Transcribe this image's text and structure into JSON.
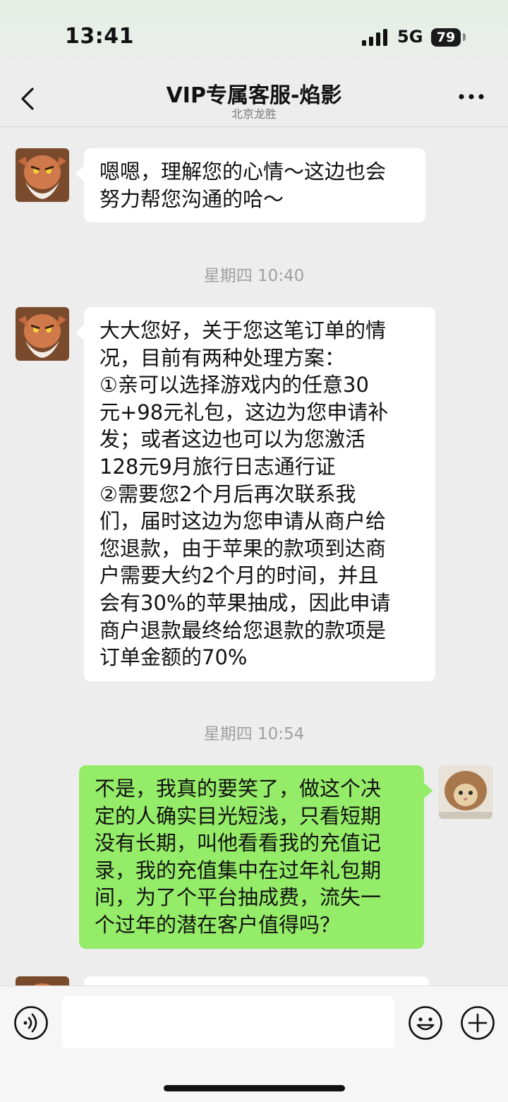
{
  "status_bar": {
    "time": "13:41",
    "network": "5G",
    "battery": "79"
  },
  "header": {
    "title": "VIP专属客服-焰影",
    "subtitle": "北京龙胜",
    "back_icon": "chevron-left-icon",
    "more_icon": "more-dots-icon"
  },
  "messages": [
    {
      "sender": "agent",
      "text": "嗯嗯，理解您的心情～这边也会\n努力帮您沟通的哈～"
    },
    {
      "timestamp": "星期四 10:40"
    },
    {
      "sender": "agent",
      "text": "大大您好，关于您这笔订单的情\n况，目前有两种处理方案：\n①亲可以选择游戏内的任意30\n元+98元礼包，这边为您申请补\n发；或者这边也可以为您激活\n128元9月旅行日志通行证\n②需要您2个月后再次联系我\n们，届时这边为您申请从商户给\n您退款，由于苹果的款项到达商\n户需要大约2个月的时间，并且\n会有30%的苹果抽成，因此申请\n商户退款最终给您退款的款项是\n订单金额的70%"
    },
    {
      "timestamp": "星期四 10:54"
    },
    {
      "sender": "user",
      "text": "不是，我真的要笑了，做这个决\n定的人确实目光短浅，只看短期\n没有长期，叫他看看我的充值记\n录，我的充值集中在过年礼包期\n间，为了个平台抽成费，流失一\n个过年的潜在客户值得吗？"
    },
    {
      "sender": "agent",
      "text": ""
    }
  ],
  "input_bar": {
    "voice_icon": "voice-icon",
    "input_value": "",
    "emoji_icon": "emoji-icon",
    "plus_icon": "plus-icon"
  },
  "colors": {
    "background": "#ededed",
    "agent_bubble": "#ffffff",
    "user_bubble": "#95ec69",
    "timestamp_text": "#a0a0a0"
  }
}
